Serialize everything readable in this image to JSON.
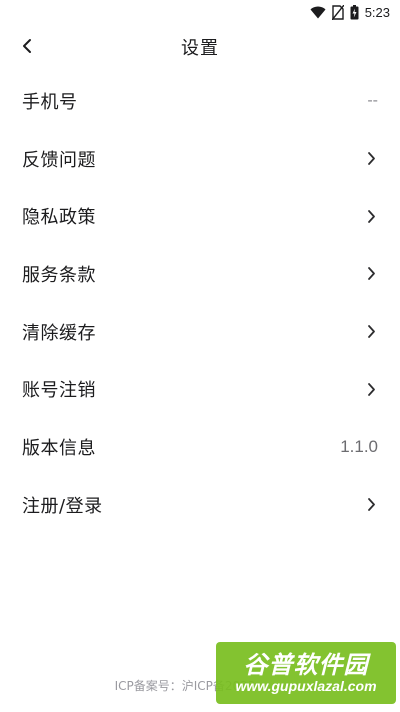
{
  "status_bar": {
    "time": "5:23",
    "icons": [
      "wifi-icon",
      "no-sim-icon",
      "battery-charging-icon"
    ]
  },
  "header": {
    "title": "设置",
    "back_icon": "chevron-left-icon"
  },
  "settings": {
    "items": [
      {
        "label": "手机号",
        "value": "--",
        "chevron": false
      },
      {
        "label": "反馈问题",
        "value": "",
        "chevron": true
      },
      {
        "label": "隐私政策",
        "value": "",
        "chevron": true
      },
      {
        "label": "服务条款",
        "value": "",
        "chevron": true
      },
      {
        "label": "清除缓存",
        "value": "",
        "chevron": true
      },
      {
        "label": "账号注销",
        "value": "",
        "chevron": true
      },
      {
        "label": "版本信息",
        "value": "1.1.0",
        "chevron": false
      },
      {
        "label": "注册/登录",
        "value": "",
        "chevron": true
      }
    ]
  },
  "footer": {
    "icp": "ICP备案号：沪ICP备2023"
  },
  "watermark": {
    "title": "谷普软件园",
    "url": "www.gupuxlazal.com"
  },
  "colors": {
    "text": "#1c1c1e",
    "secondary": "#8e8e93",
    "watermark_bg": "#78be1e"
  }
}
